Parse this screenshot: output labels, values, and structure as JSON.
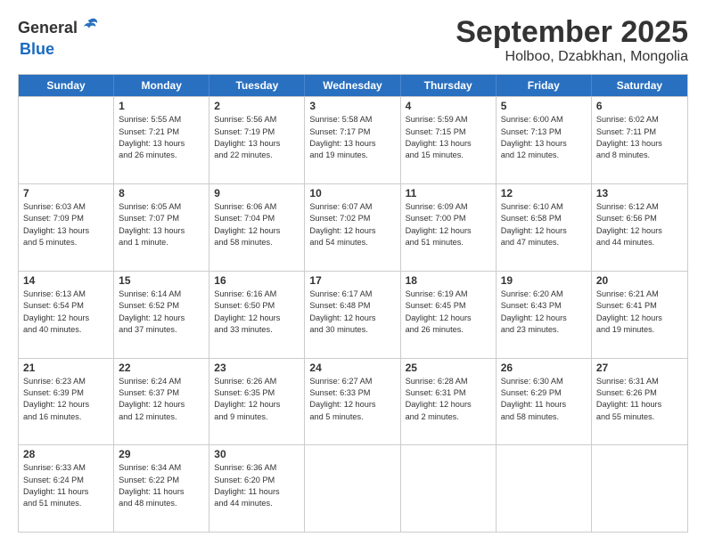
{
  "logo": {
    "general": "General",
    "blue": "Blue"
  },
  "title": "September 2025",
  "subtitle": "Holboo, Dzabkhan, Mongolia",
  "headers": [
    "Sunday",
    "Monday",
    "Tuesday",
    "Wednesday",
    "Thursday",
    "Friday",
    "Saturday"
  ],
  "weeks": [
    [
      {
        "day": "",
        "lines": []
      },
      {
        "day": "1",
        "lines": [
          "Sunrise: 5:55 AM",
          "Sunset: 7:21 PM",
          "Daylight: 13 hours",
          "and 26 minutes."
        ]
      },
      {
        "day": "2",
        "lines": [
          "Sunrise: 5:56 AM",
          "Sunset: 7:19 PM",
          "Daylight: 13 hours",
          "and 22 minutes."
        ]
      },
      {
        "day": "3",
        "lines": [
          "Sunrise: 5:58 AM",
          "Sunset: 7:17 PM",
          "Daylight: 13 hours",
          "and 19 minutes."
        ]
      },
      {
        "day": "4",
        "lines": [
          "Sunrise: 5:59 AM",
          "Sunset: 7:15 PM",
          "Daylight: 13 hours",
          "and 15 minutes."
        ]
      },
      {
        "day": "5",
        "lines": [
          "Sunrise: 6:00 AM",
          "Sunset: 7:13 PM",
          "Daylight: 13 hours",
          "and 12 minutes."
        ]
      },
      {
        "day": "6",
        "lines": [
          "Sunrise: 6:02 AM",
          "Sunset: 7:11 PM",
          "Daylight: 13 hours",
          "and 8 minutes."
        ]
      }
    ],
    [
      {
        "day": "7",
        "lines": [
          "Sunrise: 6:03 AM",
          "Sunset: 7:09 PM",
          "Daylight: 13 hours",
          "and 5 minutes."
        ]
      },
      {
        "day": "8",
        "lines": [
          "Sunrise: 6:05 AM",
          "Sunset: 7:07 PM",
          "Daylight: 13 hours",
          "and 1 minute."
        ]
      },
      {
        "day": "9",
        "lines": [
          "Sunrise: 6:06 AM",
          "Sunset: 7:04 PM",
          "Daylight: 12 hours",
          "and 58 minutes."
        ]
      },
      {
        "day": "10",
        "lines": [
          "Sunrise: 6:07 AM",
          "Sunset: 7:02 PM",
          "Daylight: 12 hours",
          "and 54 minutes."
        ]
      },
      {
        "day": "11",
        "lines": [
          "Sunrise: 6:09 AM",
          "Sunset: 7:00 PM",
          "Daylight: 12 hours",
          "and 51 minutes."
        ]
      },
      {
        "day": "12",
        "lines": [
          "Sunrise: 6:10 AM",
          "Sunset: 6:58 PM",
          "Daylight: 12 hours",
          "and 47 minutes."
        ]
      },
      {
        "day": "13",
        "lines": [
          "Sunrise: 6:12 AM",
          "Sunset: 6:56 PM",
          "Daylight: 12 hours",
          "and 44 minutes."
        ]
      }
    ],
    [
      {
        "day": "14",
        "lines": [
          "Sunrise: 6:13 AM",
          "Sunset: 6:54 PM",
          "Daylight: 12 hours",
          "and 40 minutes."
        ]
      },
      {
        "day": "15",
        "lines": [
          "Sunrise: 6:14 AM",
          "Sunset: 6:52 PM",
          "Daylight: 12 hours",
          "and 37 minutes."
        ]
      },
      {
        "day": "16",
        "lines": [
          "Sunrise: 6:16 AM",
          "Sunset: 6:50 PM",
          "Daylight: 12 hours",
          "and 33 minutes."
        ]
      },
      {
        "day": "17",
        "lines": [
          "Sunrise: 6:17 AM",
          "Sunset: 6:48 PM",
          "Daylight: 12 hours",
          "and 30 minutes."
        ]
      },
      {
        "day": "18",
        "lines": [
          "Sunrise: 6:19 AM",
          "Sunset: 6:45 PM",
          "Daylight: 12 hours",
          "and 26 minutes."
        ]
      },
      {
        "day": "19",
        "lines": [
          "Sunrise: 6:20 AM",
          "Sunset: 6:43 PM",
          "Daylight: 12 hours",
          "and 23 minutes."
        ]
      },
      {
        "day": "20",
        "lines": [
          "Sunrise: 6:21 AM",
          "Sunset: 6:41 PM",
          "Daylight: 12 hours",
          "and 19 minutes."
        ]
      }
    ],
    [
      {
        "day": "21",
        "lines": [
          "Sunrise: 6:23 AM",
          "Sunset: 6:39 PM",
          "Daylight: 12 hours",
          "and 16 minutes."
        ]
      },
      {
        "day": "22",
        "lines": [
          "Sunrise: 6:24 AM",
          "Sunset: 6:37 PM",
          "Daylight: 12 hours",
          "and 12 minutes."
        ]
      },
      {
        "day": "23",
        "lines": [
          "Sunrise: 6:26 AM",
          "Sunset: 6:35 PM",
          "Daylight: 12 hours",
          "and 9 minutes."
        ]
      },
      {
        "day": "24",
        "lines": [
          "Sunrise: 6:27 AM",
          "Sunset: 6:33 PM",
          "Daylight: 12 hours",
          "and 5 minutes."
        ]
      },
      {
        "day": "25",
        "lines": [
          "Sunrise: 6:28 AM",
          "Sunset: 6:31 PM",
          "Daylight: 12 hours",
          "and 2 minutes."
        ]
      },
      {
        "day": "26",
        "lines": [
          "Sunrise: 6:30 AM",
          "Sunset: 6:29 PM",
          "Daylight: 11 hours",
          "and 58 minutes."
        ]
      },
      {
        "day": "27",
        "lines": [
          "Sunrise: 6:31 AM",
          "Sunset: 6:26 PM",
          "Daylight: 11 hours",
          "and 55 minutes."
        ]
      }
    ],
    [
      {
        "day": "28",
        "lines": [
          "Sunrise: 6:33 AM",
          "Sunset: 6:24 PM",
          "Daylight: 11 hours",
          "and 51 minutes."
        ]
      },
      {
        "day": "29",
        "lines": [
          "Sunrise: 6:34 AM",
          "Sunset: 6:22 PM",
          "Daylight: 11 hours",
          "and 48 minutes."
        ]
      },
      {
        "day": "30",
        "lines": [
          "Sunrise: 6:36 AM",
          "Sunset: 6:20 PM",
          "Daylight: 11 hours",
          "and 44 minutes."
        ]
      },
      {
        "day": "",
        "lines": []
      },
      {
        "day": "",
        "lines": []
      },
      {
        "day": "",
        "lines": []
      },
      {
        "day": "",
        "lines": []
      }
    ]
  ]
}
